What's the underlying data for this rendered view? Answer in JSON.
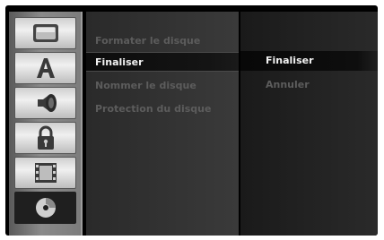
{
  "sidebar": {
    "items": [
      {
        "icon": "tv-screen-icon"
      },
      {
        "icon": "text-a-icon"
      },
      {
        "icon": "speaker-icon"
      },
      {
        "icon": "lock-icon"
      },
      {
        "icon": "film-icon"
      },
      {
        "icon": "disc-icon",
        "active": true
      }
    ]
  },
  "main_menu": {
    "items": [
      "Formater le disque",
      "Finaliser",
      "Nommer le disque",
      "Protection du disque"
    ],
    "selected_index": 1
  },
  "sub_menu": {
    "items": [
      "Finaliser",
      "Annuler"
    ],
    "selected_index": 0
  },
  "colors": {
    "highlight_text": "#f2f2f2",
    "dim_text": "#5c5c5c"
  }
}
